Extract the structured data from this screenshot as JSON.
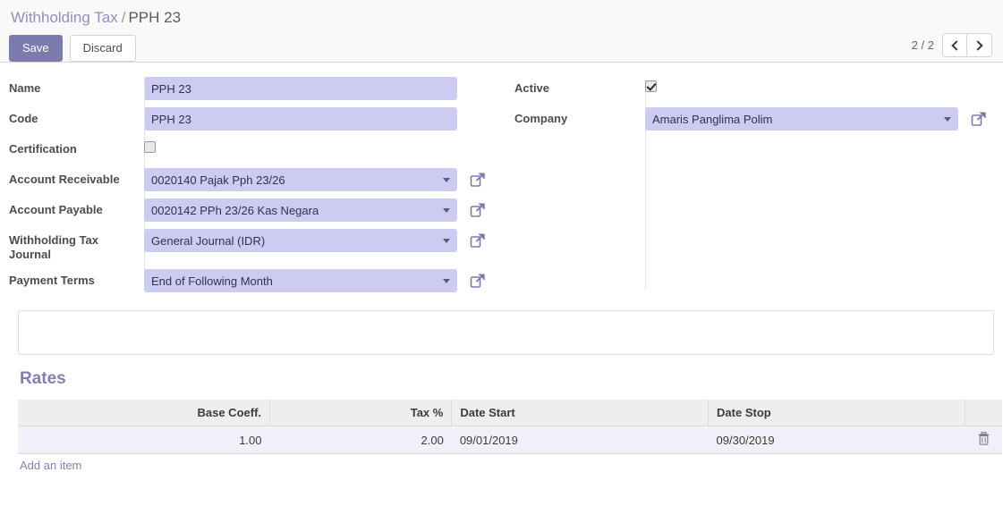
{
  "breadcrumb": {
    "root": "Withholding Tax",
    "separator": "/",
    "current": "PPH 23"
  },
  "toolbar": {
    "save_label": "Save",
    "discard_label": "Discard"
  },
  "pager": {
    "count": "2 / 2",
    "prev_icon": "chevron-left-icon",
    "next_icon": "chevron-right-icon"
  },
  "form": {
    "left": {
      "name_label": "Name",
      "name_value": "PPH 23",
      "code_label": "Code",
      "code_value": "PPH 23",
      "certification_label": "Certification",
      "certification_checked": false,
      "account_receivable_label": "Account Receivable",
      "account_receivable_value": "0020140 Pajak Pph 23/26",
      "account_payable_label": "Account Payable",
      "account_payable_value": "0020142 PPh 23/26 Kas Negara",
      "journal_label": "Withholding Tax Journal",
      "journal_value": "General Journal (IDR)",
      "payment_terms_label": "Payment Terms",
      "payment_terms_value": "End of Following Month"
    },
    "right": {
      "active_label": "Active",
      "active_checked": true,
      "company_label": "Company",
      "company_value": "Amaris Panglima Polim"
    }
  },
  "notes": {
    "value": "",
    "placeholder": ""
  },
  "rates": {
    "title": "Rates",
    "columns": [
      "Base Coeff.",
      "Tax %",
      "Date Start",
      "Date Stop"
    ],
    "rows": [
      {
        "base_coeff": "1.00",
        "tax_pct": "2.00",
        "date_start": "09/01/2019",
        "date_stop": "09/30/2019",
        "delete_icon": "trash-icon"
      }
    ],
    "add_item_label": "Add an item"
  },
  "colors": {
    "accent": "#7c7bad",
    "field_bg": "#ccccf2",
    "link": "#8080b3"
  }
}
